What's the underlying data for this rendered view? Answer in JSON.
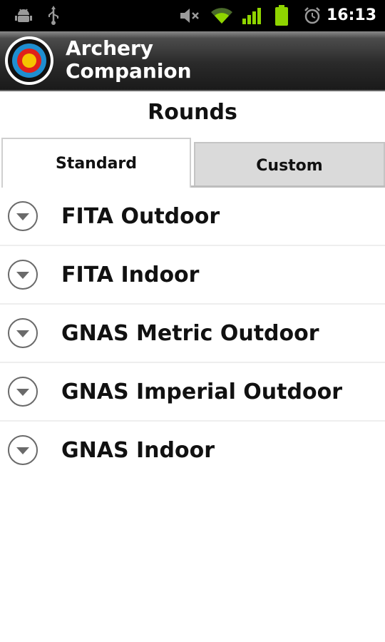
{
  "status_bar": {
    "time": "16:13",
    "icons": [
      "android-debug-icon",
      "usb-icon",
      "mute-icon",
      "wifi-icon",
      "signal-icon",
      "battery-icon",
      "alarm-icon"
    ]
  },
  "app": {
    "title_line1": "Archery",
    "title_line2": "Companion",
    "logo_icon": "archery-target-icon"
  },
  "page": {
    "heading": "Rounds"
  },
  "tabs": [
    {
      "label": "Standard",
      "selected": true
    },
    {
      "label": "Custom",
      "selected": false
    }
  ],
  "rounds": [
    {
      "label": "FITA Outdoor",
      "icon": "expand-icon"
    },
    {
      "label": "FITA Indoor",
      "icon": "expand-icon"
    },
    {
      "label": "GNAS Metric Outdoor",
      "icon": "expand-icon"
    },
    {
      "label": "GNAS Imperial Outdoor",
      "icon": "expand-icon"
    },
    {
      "label": "GNAS Indoor",
      "icon": "expand-icon"
    }
  ],
  "colors": {
    "status_bar": "#000000",
    "title_bar": "#2a2a2a",
    "target_yellow": "#f5c400",
    "target_red": "#e0201a",
    "target_blue": "#1f8ed0",
    "target_black": "#111111",
    "battery_green": "#8fd400"
  }
}
